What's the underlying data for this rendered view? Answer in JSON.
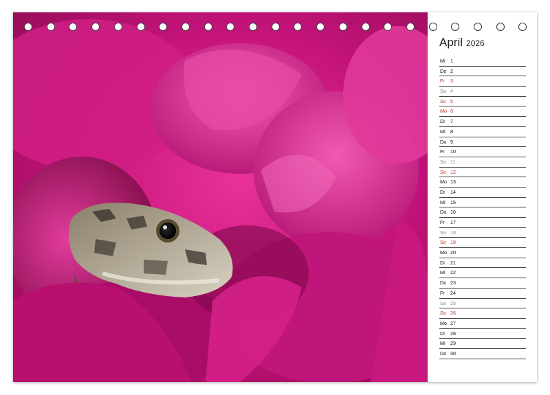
{
  "calendar": {
    "month": "April",
    "year": "2026",
    "days": [
      {
        "wd": "Mi",
        "d": "1",
        "type": "weekday"
      },
      {
        "wd": "Do",
        "d": "2",
        "type": "weekday"
      },
      {
        "wd": "Fr",
        "d": "3",
        "type": "holiday"
      },
      {
        "wd": "Sa",
        "d": "4",
        "type": "sat"
      },
      {
        "wd": "So",
        "d": "5",
        "type": "sun"
      },
      {
        "wd": "Mo",
        "d": "6",
        "type": "holiday"
      },
      {
        "wd": "Di",
        "d": "7",
        "type": "weekday"
      },
      {
        "wd": "Mi",
        "d": "8",
        "type": "weekday"
      },
      {
        "wd": "Do",
        "d": "9",
        "type": "weekday"
      },
      {
        "wd": "Fr",
        "d": "10",
        "type": "weekday"
      },
      {
        "wd": "Sa",
        "d": "11",
        "type": "sat"
      },
      {
        "wd": "So",
        "d": "12",
        "type": "sun"
      },
      {
        "wd": "Mo",
        "d": "13",
        "type": "weekday"
      },
      {
        "wd": "Di",
        "d": "14",
        "type": "weekday"
      },
      {
        "wd": "Mi",
        "d": "15",
        "type": "weekday"
      },
      {
        "wd": "Do",
        "d": "16",
        "type": "weekday"
      },
      {
        "wd": "Fr",
        "d": "17",
        "type": "weekday"
      },
      {
        "wd": "Sa",
        "d": "18",
        "type": "sat"
      },
      {
        "wd": "So",
        "d": "19",
        "type": "sun"
      },
      {
        "wd": "Mo",
        "d": "20",
        "type": "weekday"
      },
      {
        "wd": "Di",
        "d": "21",
        "type": "weekday"
      },
      {
        "wd": "Mi",
        "d": "22",
        "type": "weekday"
      },
      {
        "wd": "Do",
        "d": "23",
        "type": "weekday"
      },
      {
        "wd": "Fr",
        "d": "24",
        "type": "weekday"
      },
      {
        "wd": "Sa",
        "d": "25",
        "type": "sat"
      },
      {
        "wd": "So",
        "d": "26",
        "type": "sun"
      },
      {
        "wd": "Mo",
        "d": "27",
        "type": "weekday"
      },
      {
        "wd": "Di",
        "d": "28",
        "type": "weekday"
      },
      {
        "wd": "Mi",
        "d": "29",
        "type": "weekday"
      },
      {
        "wd": "Do",
        "d": "30",
        "type": "weekday"
      }
    ]
  },
  "photo": {
    "subject": "lizard-among-magenta-bougainvillea",
    "colors": {
      "primary": "#d4187f",
      "deep": "#8a0a4a",
      "light": "#f04aa8"
    }
  },
  "binding": {
    "hole_count": 23,
    "icon": "spiral-binding-hole"
  },
  "colors": {
    "sunday": "#c0392b",
    "saturday": "#8a8a8a",
    "text": "#111111"
  }
}
